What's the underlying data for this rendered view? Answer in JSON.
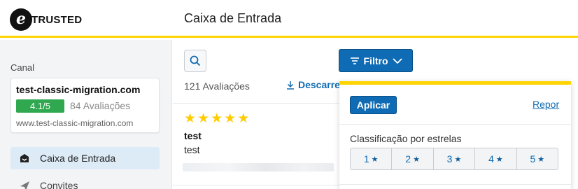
{
  "brand": {
    "logo_letter": "e",
    "logo_text": "TRUSTED"
  },
  "header": {
    "title": "Caixa de Entrada"
  },
  "sidebar": {
    "canal_label": "Canal",
    "channel": {
      "name": "test-classic-migration.com",
      "score": "4.1/5",
      "reviews": "84 Avaliações",
      "url": "www.test-classic-migration.com"
    },
    "items": [
      {
        "label": "Caixa de Entrada",
        "icon": "inbox-icon",
        "active": true
      },
      {
        "label": "Convites",
        "icon": "send-icon",
        "active": false
      }
    ]
  },
  "main": {
    "filter_label": "Filtro",
    "reviews_count": "121 Avaliações",
    "download_label": "Descarregar",
    "review": {
      "stars": 5,
      "title": "test",
      "text": "test"
    }
  },
  "filter_panel": {
    "apply_label": "Aplicar",
    "reset_label": "Repor",
    "rating_label": "Classificação por estrelas",
    "rating_options": [
      "1",
      "2",
      "3",
      "4",
      "5"
    ]
  },
  "colors": {
    "accent": "#0f6bb3",
    "brand_yellow": "#ffd400",
    "score_green": "#2fa84f",
    "star": "#ffcc00"
  }
}
